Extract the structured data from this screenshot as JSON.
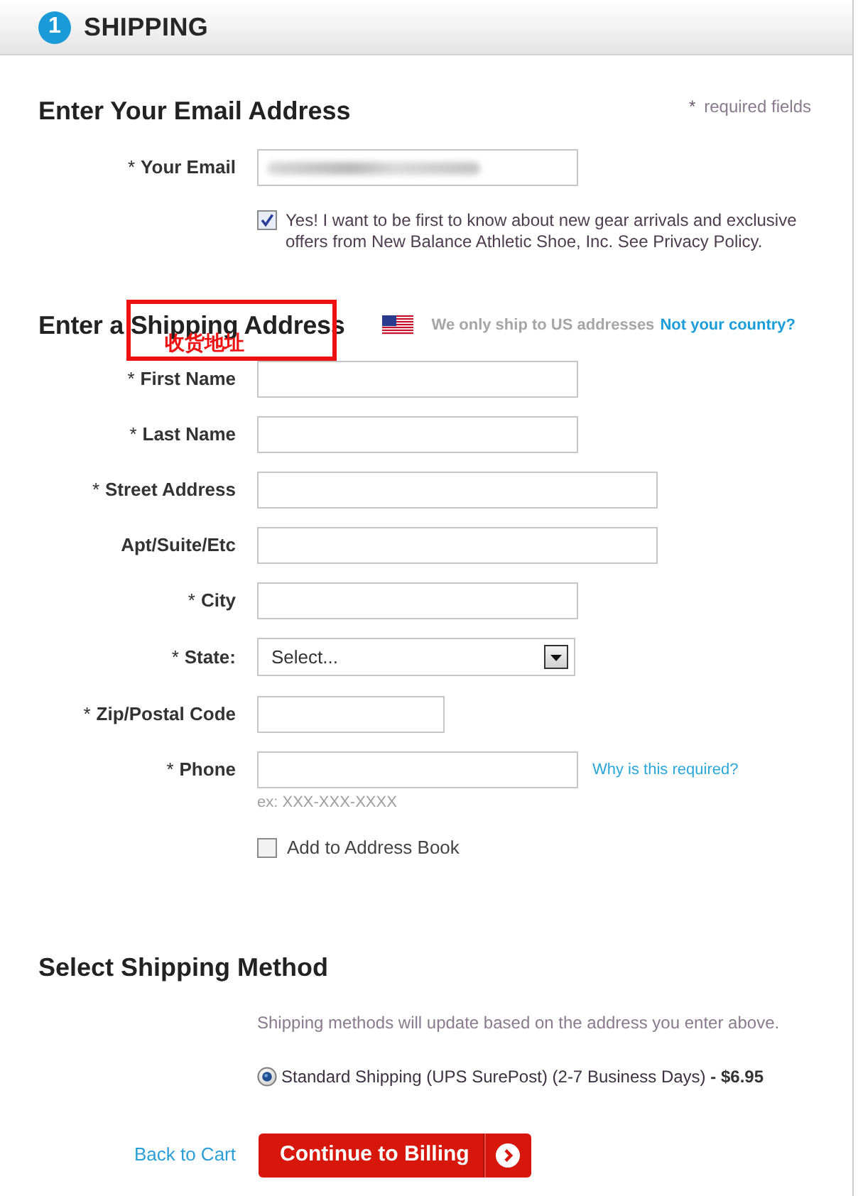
{
  "header": {
    "step": "1",
    "title": "SHIPPING"
  },
  "email_section": {
    "title": "Enter Your Email Address",
    "required_note": {
      "mark": "*",
      "text": "required fields"
    },
    "fields": [
      {
        "kind": "input",
        "mark": "*",
        "label": "Your Email",
        "blurred": true
      }
    ],
    "newsletter": {
      "checked": true,
      "text": "Yes! I want to be first to know about new gear arrivals and exclusive offers from New Balance Athletic Shoe, Inc. See",
      "link": "Privacy Policy",
      "after_link": "."
    }
  },
  "address_section": {
    "title": "Enter a Shipping Address",
    "annotation": {
      "text": "收货地址"
    },
    "note": "We only ship to US addresses",
    "note_link": "Not your country?",
    "fields": [
      {
        "kind": "input",
        "mark": "*",
        "label": "First Name"
      },
      {
        "kind": "input",
        "mark": "*",
        "label": "Last Name"
      },
      {
        "kind": "wide-input",
        "mark": "*",
        "label": "Street Address"
      },
      {
        "kind": "wide-input",
        "label": "Apt/Suite/Etc"
      },
      {
        "kind": "input",
        "mark": "*",
        "label": "City"
      },
      {
        "kind": "select",
        "mark": "*",
        "label": "State:",
        "value": "Select..."
      },
      {
        "kind": "short-input",
        "mark": "*",
        "label": "Zip/Postal Code"
      },
      {
        "kind": "input",
        "mark": "*",
        "label": "Phone",
        "help_link": "Why is this required?",
        "example": "ex: XXX-XXX-XXXX"
      }
    ],
    "address_book": {
      "checked": false,
      "label": "Add to Address Book"
    }
  },
  "shipping_section": {
    "title": "Select Shipping Method",
    "hint": "Shipping methods will update based on the address you enter above.",
    "options": [
      {
        "selected": true,
        "label": "Standard Shipping (UPS SurePost) (2-7 Business Days) **- $6.95**"
      }
    ]
  },
  "actions": {
    "back_link": "Back to Cart",
    "continue_button": "Continue to Billing"
  }
}
